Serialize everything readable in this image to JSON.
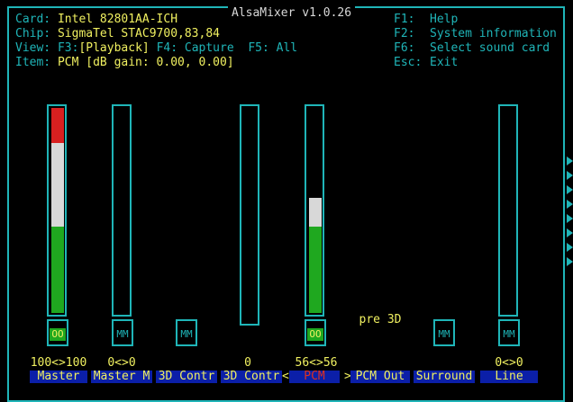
{
  "title": "AlsaMixer v1.0.26",
  "header": {
    "card_label": "Card:",
    "card_value": "Intel 82801AA-ICH",
    "chip_label": "Chip:",
    "chip_value": "SigmaTel STAC9700,83,84",
    "view_label": "View:",
    "view_f3": "F3:",
    "view_playback": "[Playback]",
    "view_f4": "F4: Capture",
    "view_f5": "F5: All",
    "item_label": "Item:",
    "item_value": "PCM [dB gain: 0.00, 0.00]"
  },
  "keys": [
    {
      "key": "F1:",
      "desc": "Help"
    },
    {
      "key": "F2:",
      "desc": "System information"
    },
    {
      "key": "F6:",
      "desc": "Select sound card"
    },
    {
      "key": "Esc:",
      "desc": "Exit"
    }
  ],
  "channels": [
    {
      "name": "Master",
      "volume": "100<>100",
      "level": 1.0,
      "mute": "OO",
      "muted": false,
      "selected": false
    },
    {
      "name": "Master M",
      "volume": "0<>0",
      "level": 0.0,
      "mute": "MM",
      "muted": true,
      "selected": false
    },
    {
      "name": "3D Contr",
      "volume": "",
      "level": null,
      "mute": "MM",
      "muted": true,
      "selected": false
    },
    {
      "name": "3D Contr",
      "volume": "0",
      "level": 0.0,
      "mute": "",
      "muted": null,
      "selected": false
    },
    {
      "name": "PCM",
      "volume": "56<>56",
      "level": 0.56,
      "mute": "OO",
      "muted": false,
      "selected": true
    },
    {
      "name": "PCM Out",
      "volume": "",
      "level": null,
      "mute": "",
      "muted": null,
      "selected": false
    },
    {
      "name": "Surround",
      "volume": "",
      "level": null,
      "mute": "MM",
      "muted": true,
      "selected": false
    },
    {
      "name": "Line",
      "volume": "0<>0",
      "level": 0.0,
      "mute": "MM",
      "muted": true,
      "selected": false
    }
  ],
  "pcm_out_value": "pre 3D",
  "selected_markers": {
    "left": "<",
    "right": ">"
  },
  "colors": {
    "frame": "#1fb5b8",
    "value_yellow": "#f0f060",
    "level_green": "#1fa81f",
    "level_white": "#d8d8d8",
    "level_red": "#d82020",
    "name_bg": "#0b1fa8",
    "selected_name": "#e03020"
  }
}
